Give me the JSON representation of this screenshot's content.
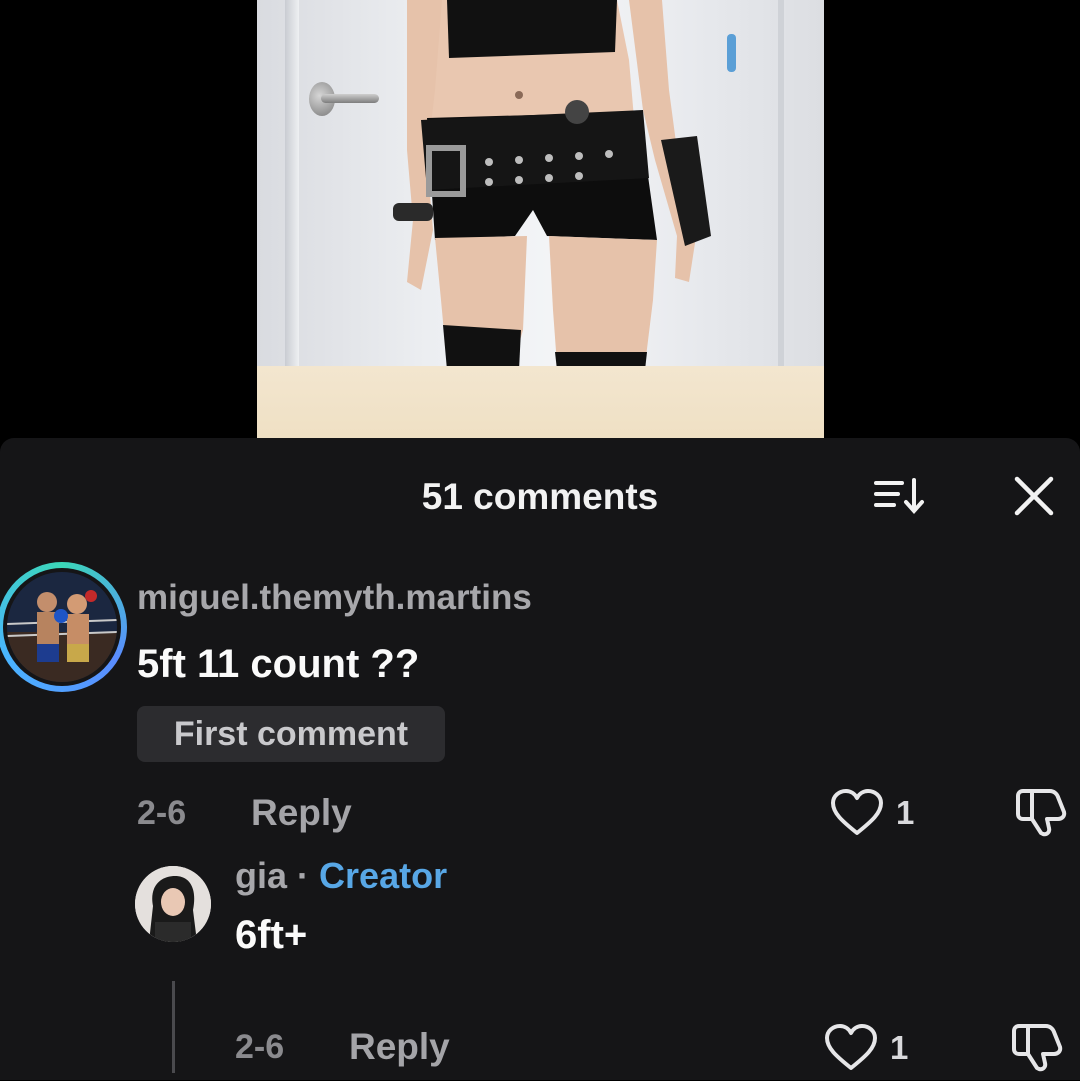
{
  "comments_panel": {
    "title": "51 comments",
    "sort_icon": "sort-icon",
    "close_icon": "close-icon"
  },
  "comments": [
    {
      "username": "miguel.themyth.martins",
      "text": "5ft 11 count ??",
      "badge": "First comment",
      "date": "2-6",
      "reply_label": "Reply",
      "likes": "1",
      "avatar": "boxing-match-avatar"
    },
    {
      "username": "gia",
      "separator": "·",
      "role_badge": "Creator",
      "text": "6ft+",
      "date": "2-6",
      "reply_label": "Reply",
      "likes": "1",
      "avatar": "creator-avatar"
    }
  ],
  "colors": {
    "panel_bg": "#151517",
    "creator_accent": "#58a7e6",
    "badge_bg": "#2c2c2f"
  }
}
